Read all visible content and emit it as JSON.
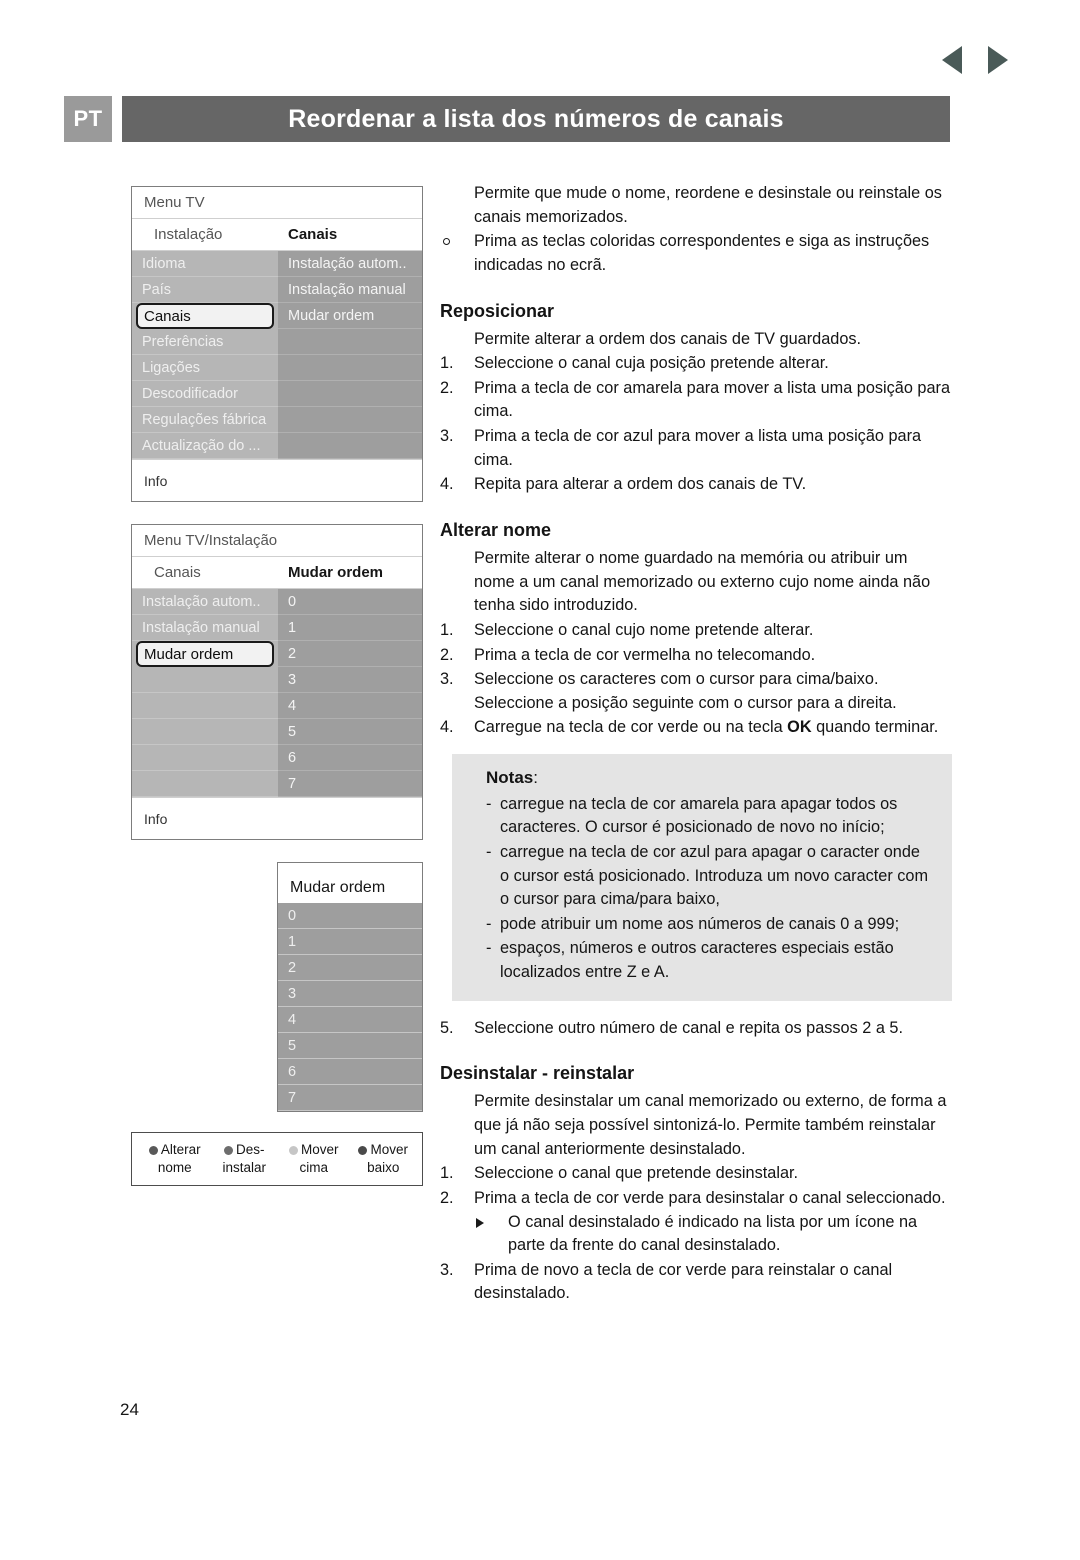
{
  "nav": {
    "prev_icon": "arrow-left-icon",
    "next_icon": "arrow-right-icon"
  },
  "header": {
    "language_code": "PT",
    "title": "Reordenar a lista dos números de canais"
  },
  "page_number": "24",
  "colors": {
    "header_bar": "#666666",
    "lang_badge": "#9a9a9a",
    "menu_left_col": "#b6b6b6",
    "menu_right_col": "#9e9e9e",
    "notes_bg": "#e4e4e4",
    "arrow": "#4a5a58"
  },
  "tv_screens": [
    {
      "title": "Menu TV",
      "sub_left": "Instalação",
      "sub_right": "Canais",
      "info": "Info",
      "left_items": [
        {
          "label": "Idioma",
          "selected": false
        },
        {
          "label": "País",
          "selected": false
        },
        {
          "label": "Canais",
          "selected": true
        },
        {
          "label": "Preferências",
          "selected": false
        },
        {
          "label": "Ligações",
          "selected": false
        },
        {
          "label": "Descodificador",
          "selected": false
        },
        {
          "label": "Regulações fábrica",
          "selected": false
        },
        {
          "label": "Actualização do ...",
          "selected": false
        }
      ],
      "right_items": [
        {
          "label": "Instalação autom.."
        },
        {
          "label": "Instalação manual"
        },
        {
          "label": "Mudar ordem"
        },
        {
          "label": ""
        },
        {
          "label": ""
        },
        {
          "label": ""
        },
        {
          "label": ""
        },
        {
          "label": ""
        }
      ]
    },
    {
      "title": "Menu TV/Instalação",
      "sub_left": "Canais",
      "sub_right": "Mudar ordem",
      "info": "Info",
      "left_items": [
        {
          "label": "Instalação autom..",
          "selected": false
        },
        {
          "label": "Instalação manual",
          "selected": false
        },
        {
          "label": "Mudar ordem",
          "selected": true
        },
        {
          "label": "",
          "selected": false
        },
        {
          "label": "",
          "selected": false
        },
        {
          "label": "",
          "selected": false
        },
        {
          "label": "",
          "selected": false
        },
        {
          "label": "",
          "selected": false
        }
      ],
      "right_items": [
        {
          "label": "0"
        },
        {
          "label": "1"
        },
        {
          "label": "2"
        },
        {
          "label": "3"
        },
        {
          "label": "4"
        },
        {
          "label": "5"
        },
        {
          "label": "6"
        },
        {
          "label": "7"
        }
      ]
    }
  ],
  "tv_screen_3": {
    "title": "Mudar ordem",
    "items": [
      {
        "label": "0"
      },
      {
        "label": "1"
      },
      {
        "label": "2"
      },
      {
        "label": "3"
      },
      {
        "label": "4"
      },
      {
        "label": "5"
      },
      {
        "label": "6"
      },
      {
        "label": "7"
      }
    ]
  },
  "color_keys": [
    {
      "line1": "Alterar",
      "line2": "nome",
      "dot": "#595959",
      "dot_name": "red-key-dot"
    },
    {
      "line1": "Des-",
      "line2": "instalar",
      "dot": "#6d6d6d",
      "dot_name": "green-key-dot"
    },
    {
      "line1": "Mover",
      "line2": "cima",
      "dot": "#c6c6c6",
      "dot_name": "yellow-key-dot"
    },
    {
      "line1": "Mover",
      "line2": "baixo",
      "dot": "#4a4a4a",
      "dot_name": "blue-key-dot"
    }
  ],
  "content": {
    "intro_p1": "Permite que mude o nome, reordene e desinstale ou reinstale os canais memorizados.",
    "intro_bullet": "Prima as teclas coloridas correspondentes e siga as instruções indicadas no ecrã.",
    "reposicionar": {
      "heading": "Reposicionar",
      "lead": "Permite alterar a ordem dos canais de TV guardados.",
      "steps": [
        {
          "num": "1.",
          "text": "Seleccione o canal cuja posição pretende alterar."
        },
        {
          "num": "2.",
          "text": "Prima a tecla de cor amarela para mover a lista uma posição para cima."
        },
        {
          "num": "3.",
          "text": "Prima a tecla de cor azul para mover a lista uma posição para cima."
        },
        {
          "num": "4.",
          "text": "Repita para alterar a ordem dos canais de TV."
        }
      ]
    },
    "alterar_nome": {
      "heading": "Alterar nome",
      "lead": "Permite alterar o nome guardado na memória ou atribuir um nome a um canal memorizado ou externo cujo nome ainda não tenha sido introduzido.",
      "steps": [
        {
          "num": "1.",
          "text": "Seleccione o canal cujo nome pretende alterar."
        },
        {
          "num": "2.",
          "text": "Prima a tecla de cor vermelha no telecomando."
        },
        {
          "num": "3.",
          "text": "Seleccione os caracteres com o cursor para cima/baixo. Seleccione a posição seguinte com o cursor para a direita."
        }
      ],
      "step4_pre": "Carregue na tecla de cor verde ou na tecla ",
      "step4_bold": "OK",
      "step4_post": " quando terminar.",
      "step4_num": "4."
    },
    "notes": {
      "title_bold": "Notas",
      "title_colon": ":",
      "items": [
        "carregue na tecla de cor amarela para apagar todos os caracteres. O cursor é posicionado de novo no início;",
        "carregue na tecla de cor azul para apagar o caracter onde o cursor está posicionado. Introduza um novo caracter com o cursor para cima/para baixo,",
        "pode atribuir um nome aos números de canais 0 a 999;",
        "espaços, números e outros caracteres especiais estão localizados entre Z e A."
      ],
      "dash": "-"
    },
    "step5": {
      "num": "5.",
      "text": "Seleccione outro número de canal e repita os passos 2 a 5."
    },
    "desinstalar": {
      "heading": "Desinstalar - reinstalar",
      "lead": "Permite desinstalar um canal memorizado ou externo, de forma a que já não seja possível sintonizá-lo. Permite também reinstalar um canal anteriormente desinstalado.",
      "steps": [
        {
          "num": "1.",
          "text": "Seleccione o canal que pretende desinstalar."
        },
        {
          "num": "2.",
          "text": "Prima a tecla de cor verde para desinstalar o canal seleccionado."
        }
      ],
      "substep": "O canal desinstalado é indicado na lista por um ícone na parte da frente do canal desinstalado.",
      "step3": {
        "num": "3.",
        "text": "Prima de novo a tecla de cor verde para reinstalar o canal desinstalado."
      }
    }
  }
}
